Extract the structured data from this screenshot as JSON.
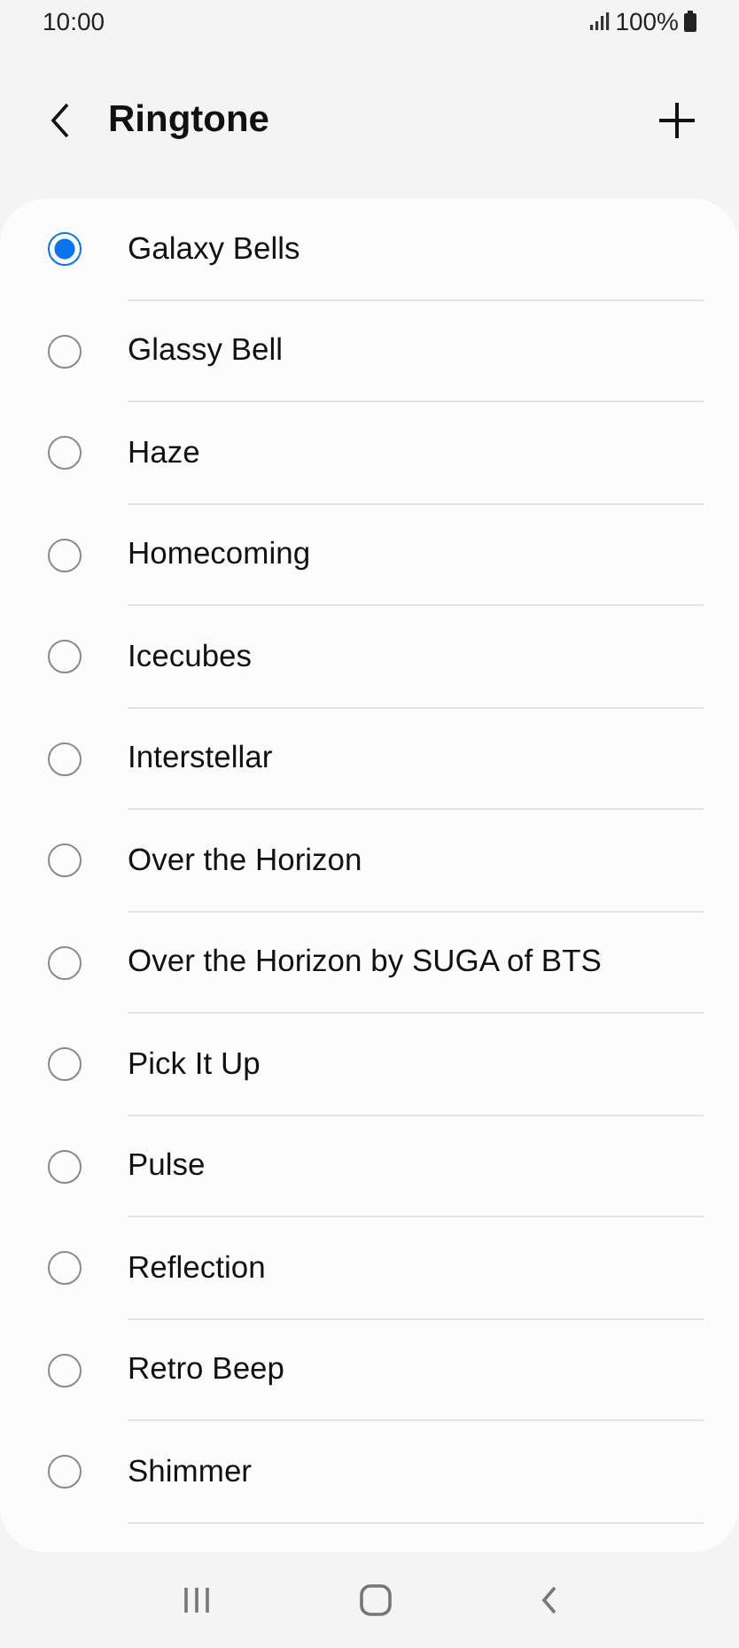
{
  "status_bar": {
    "time": "10:00",
    "battery": "100%"
  },
  "header": {
    "title": "Ringtone"
  },
  "ringtones": [
    {
      "name": "Galaxy Bells",
      "selected": true
    },
    {
      "name": "Glassy Bell",
      "selected": false
    },
    {
      "name": "Haze",
      "selected": false
    },
    {
      "name": "Homecoming",
      "selected": false
    },
    {
      "name": "Icecubes",
      "selected": false
    },
    {
      "name": "Interstellar",
      "selected": false
    },
    {
      "name": "Over the Horizon",
      "selected": false
    },
    {
      "name": "Over the Horizon by SUGA of BTS",
      "selected": false
    },
    {
      "name": "Pick It Up",
      "selected": false
    },
    {
      "name": "Pulse",
      "selected": false
    },
    {
      "name": "Reflection",
      "selected": false
    },
    {
      "name": "Retro Beep",
      "selected": false
    },
    {
      "name": "Shimmer",
      "selected": false
    }
  ]
}
